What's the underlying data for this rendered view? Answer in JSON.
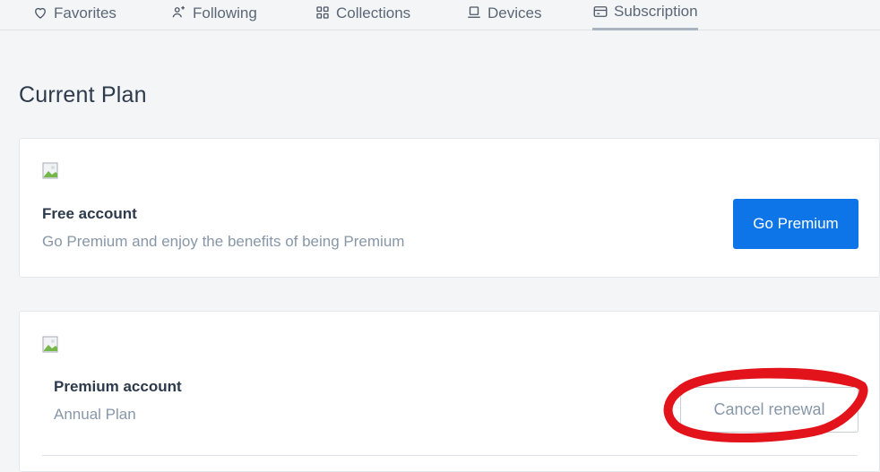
{
  "tabs": [
    {
      "label": "Favorites",
      "icon": "heart-icon",
      "active": false
    },
    {
      "label": "Following",
      "icon": "users-icon",
      "active": false
    },
    {
      "label": "Collections",
      "icon": "grid-icon",
      "active": false
    },
    {
      "label": "Devices",
      "icon": "laptop-icon",
      "active": false
    },
    {
      "label": "Subscription",
      "icon": "card-icon",
      "active": true
    }
  ],
  "page": {
    "title": "Current Plan"
  },
  "plans": {
    "free": {
      "name": "Free account",
      "description": "Go Premium and enjoy the benefits of being Premium",
      "action_label": "Go Premium"
    },
    "premium": {
      "name": "Premium account",
      "description": "Annual Plan",
      "action_label": "Cancel renewal"
    }
  },
  "colors": {
    "accent": "#0e75e8",
    "annotation": "#e3131b",
    "muted_text": "#8797a8",
    "background": "#f4f5f7"
  }
}
